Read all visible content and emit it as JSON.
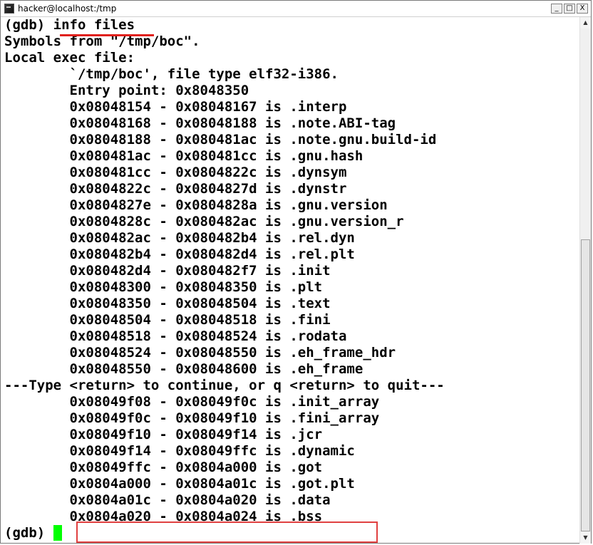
{
  "window": {
    "title": "hacker@localhost:/tmp",
    "minimize_glyph": "_",
    "maximize_glyph": "□",
    "close_glyph": "X"
  },
  "terminal": {
    "lines": [
      "(gdb) info files",
      "Symbols from \"/tmp/boc\".",
      "Local exec file:",
      "        `/tmp/boc', file type elf32-i386.",
      "        Entry point: 0x8048350",
      "        0x08048154 - 0x08048167 is .interp",
      "        0x08048168 - 0x08048188 is .note.ABI-tag",
      "        0x08048188 - 0x080481ac is .note.gnu.build-id",
      "        0x080481ac - 0x080481cc is .gnu.hash",
      "        0x080481cc - 0x0804822c is .dynsym",
      "        0x0804822c - 0x0804827d is .dynstr",
      "        0x0804827e - 0x0804828a is .gnu.version",
      "        0x0804828c - 0x080482ac is .gnu.version_r",
      "        0x080482ac - 0x080482b4 is .rel.dyn",
      "        0x080482b4 - 0x080482d4 is .rel.plt",
      "        0x080482d4 - 0x080482f7 is .init",
      "        0x08048300 - 0x08048350 is .plt",
      "        0x08048350 - 0x08048504 is .text",
      "        0x08048504 - 0x08048518 is .fini",
      "        0x08048518 - 0x08048524 is .rodata",
      "        0x08048524 - 0x08048550 is .eh_frame_hdr",
      "        0x08048550 - 0x08048600 is .eh_frame",
      "---Type <return> to continue, or q <return> to quit---",
      "        0x08049f08 - 0x08049f0c is .init_array",
      "        0x08049f0c - 0x08049f10 is .fini_array",
      "        0x08049f10 - 0x08049f14 is .jcr",
      "        0x08049f14 - 0x08049ffc is .dynamic",
      "        0x08049ffc - 0x0804a000 is .got",
      "        0x0804a000 - 0x0804a01c is .got.plt",
      "        0x0804a01c - 0x0804a020 is .data",
      "        0x0804a020 - 0x0804a024 is .bss"
    ],
    "prompt": "(gdb) ",
    "cursor_color": "#00ff00"
  },
  "annotations": {
    "underline_color": "#e0201a",
    "box_color": "#e04040"
  }
}
